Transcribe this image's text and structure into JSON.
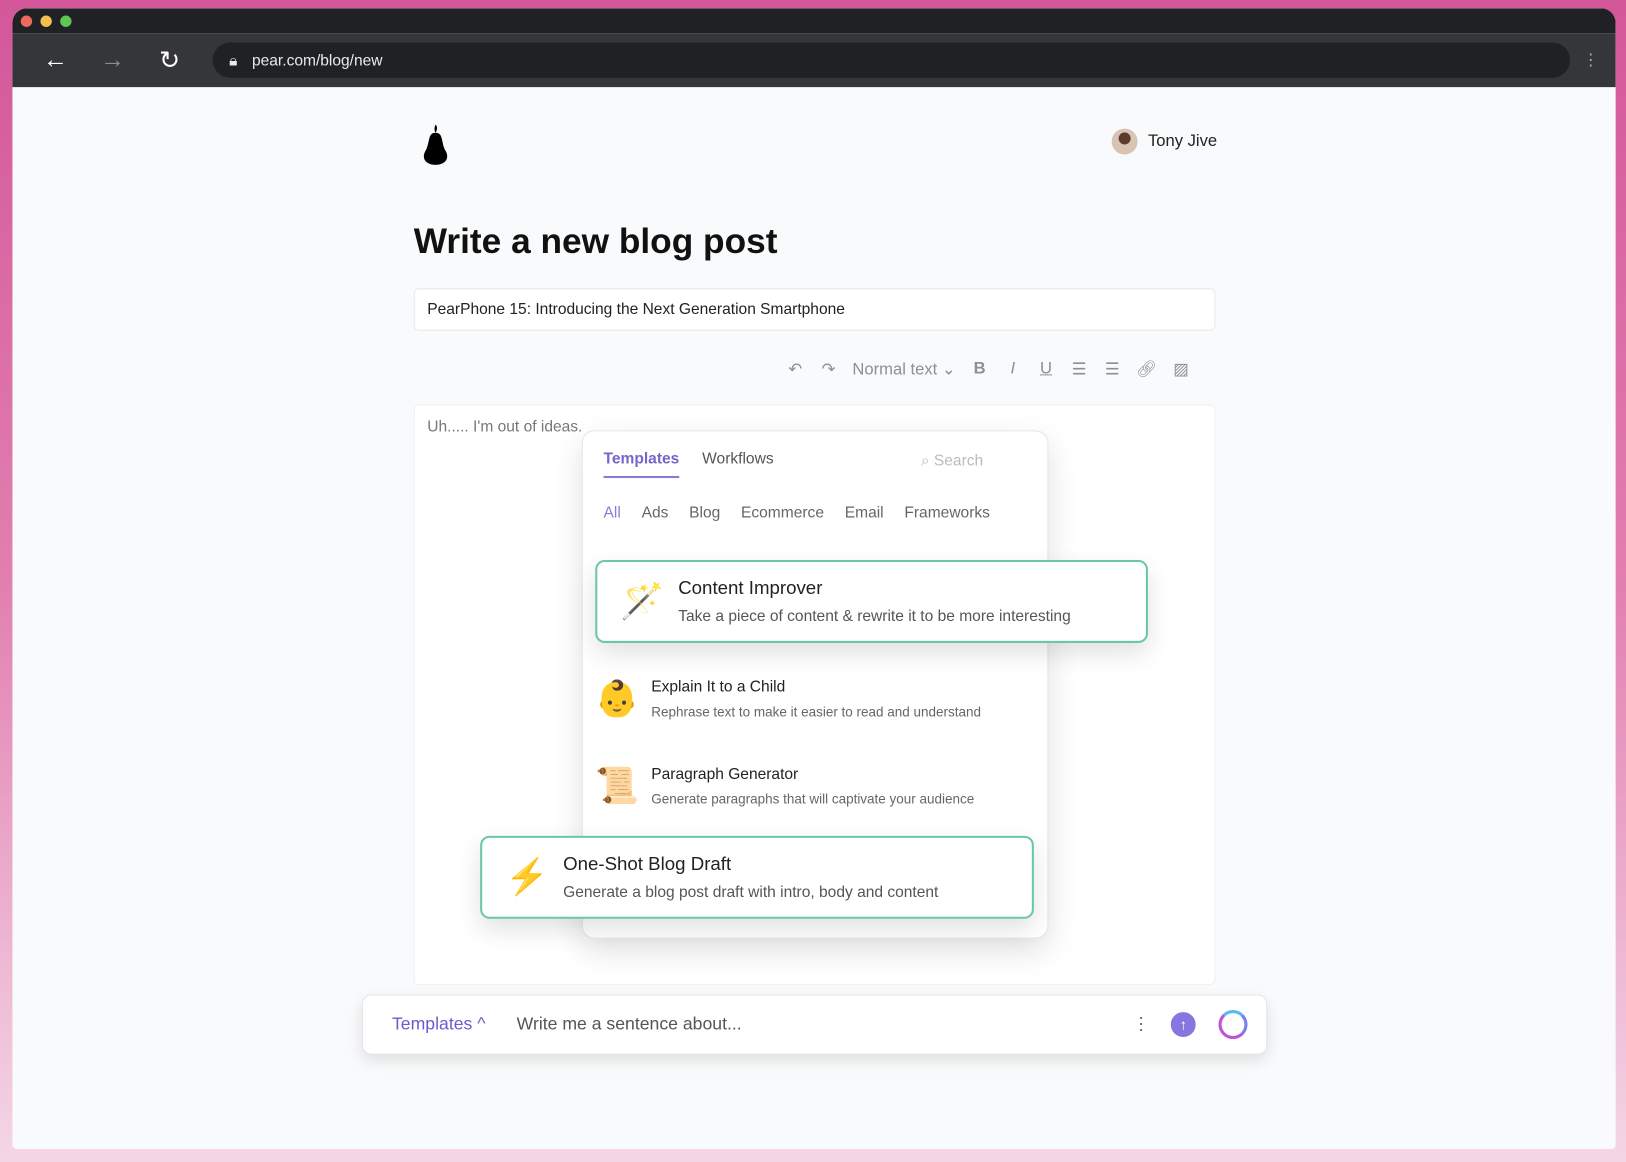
{
  "browser": {
    "url": "pear.com/blog/new",
    "traffic_lights": [
      "#ec6a5e",
      "#f4bf4f",
      "#61c554"
    ]
  },
  "header": {
    "logo": "pear-logo",
    "user_name": "Tony Jive"
  },
  "page": {
    "title": "Write a new blog post",
    "post_title": "PearPhone 15: Introducing the Next Generation Smartphone",
    "editor_text": "Uh..... I'm out of ideas."
  },
  "format_toolbar": {
    "style": "Normal text"
  },
  "panel": {
    "tabs": [
      "Templates",
      "Workflows"
    ],
    "search_placeholder": "Search",
    "categories": [
      "All",
      "Ads",
      "Blog",
      "Ecommerce",
      "Email",
      "Frameworks"
    ],
    "items": [
      {
        "title": "Content Improver",
        "desc": "Take a piece of content & rewrite it to be more interesting",
        "icon": "🪄"
      },
      {
        "title": "Explain It to a Child",
        "desc": "Rephrase text to make it easier to read and understand",
        "icon": "👶"
      },
      {
        "title": "Paragraph Generator",
        "desc": "Generate paragraphs that will captivate your audience",
        "icon": "📜"
      },
      {
        "title": "One-Shot Blog Draft",
        "desc": "Generate a blog post draft with intro, body and content",
        "icon": "⚡"
      }
    ]
  },
  "command_bar": {
    "templates_label": "Templates",
    "placeholder": "Write me a sentence about..."
  },
  "colors": {
    "accent": "#7765c9",
    "highlight_border": "#6cc7a2"
  }
}
